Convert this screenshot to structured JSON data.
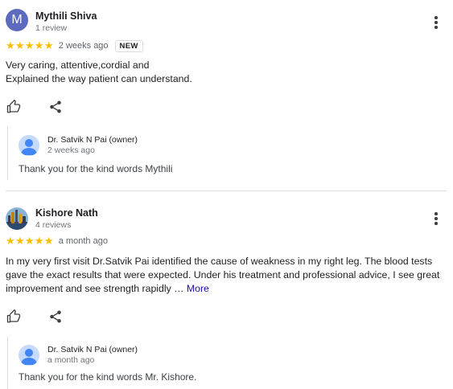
{
  "reviews": [
    {
      "author": "Mythili Shiva",
      "avatar_letter": "M",
      "sub": "1 review",
      "stars": "★★★★★",
      "rating": 5,
      "when": "2 weeks ago",
      "badge": "NEW",
      "text": "Very caring, attentive,cordial and\nExplained the way patient can understand.",
      "reply": {
        "name": "Dr. Satvik N Pai (owner)",
        "when": "2 weeks ago",
        "text": "Thank you for the kind words Mythili"
      }
    },
    {
      "author": "Kishore Nath",
      "sub": "4 reviews",
      "stars": "★★★★★",
      "rating": 5,
      "when": "a month ago",
      "text": "In my very first visit Dr.Satvik Pai identified the cause of weakness in my right leg. The blood tests gave the exact results that were expected. Under his treatment and professional advice, I see great improvement and see strength rapidly … ",
      "more_label": "More",
      "reply": {
        "name": "Dr. Satvik N Pai (owner)",
        "when": "a month ago",
        "text": "Thank you for the kind words Mr. Kishore."
      }
    }
  ],
  "colors": {
    "star": "#fbbc04",
    "link": "#1a0dab",
    "avatar_m": "#5c6bc0"
  },
  "icons": [
    "thumbs-up-icon",
    "share-icon",
    "more-vert-icon",
    "person-icon"
  ]
}
